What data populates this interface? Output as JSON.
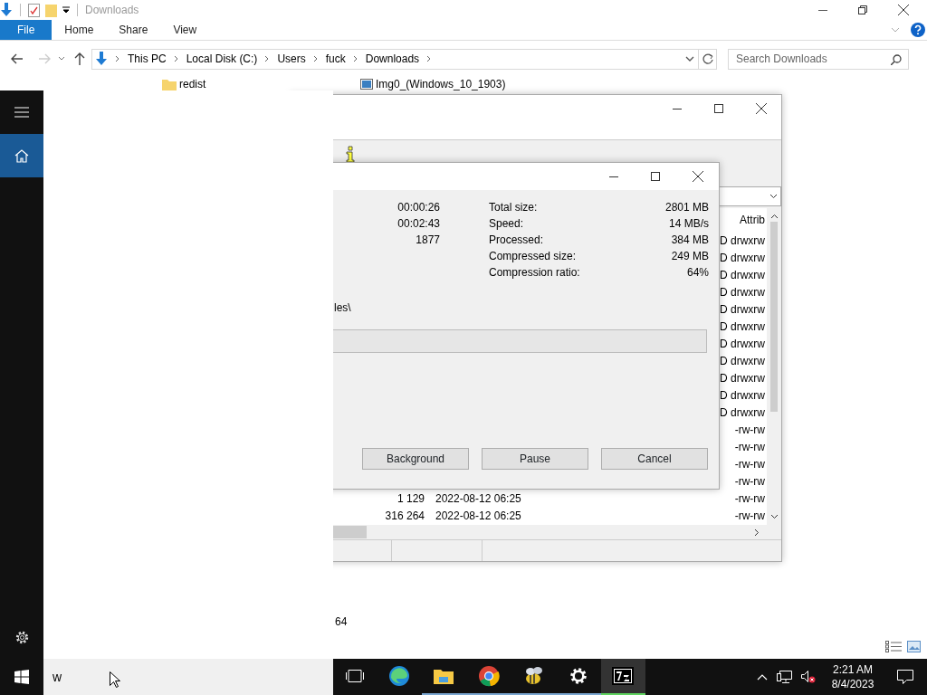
{
  "explorer": {
    "title": "Downloads",
    "ribbon_tabs": [
      {
        "label": "File",
        "selected": true
      },
      {
        "label": "Home",
        "selected": false
      },
      {
        "label": "Share",
        "selected": false
      },
      {
        "label": "View",
        "selected": false
      }
    ],
    "breadcrumb": [
      "This PC",
      "Local Disk (C:)",
      "Users",
      "fuck",
      "Downloads"
    ],
    "search": {
      "placeholder": "Search Downloads"
    },
    "items": [
      {
        "name": "redist",
        "kind": "folder"
      },
      {
        "name": "Img0_(Windows_10_1903)",
        "kind": "image"
      }
    ],
    "fragment": "64"
  },
  "file_manager": {
    "columns": [
      {
        "label": "Attrib"
      }
    ],
    "rows": [
      {
        "attrib": "D drwxrw"
      },
      {
        "attrib": "D drwxrw"
      },
      {
        "attrib": "D drwxrw"
      },
      {
        "attrib": "D drwxrw"
      },
      {
        "attrib": "D drwxrw"
      },
      {
        "attrib": "D drwxrw"
      },
      {
        "attrib": "D drwxrw"
      },
      {
        "attrib": "D drwxrw"
      },
      {
        "attrib": "D drwxrw"
      },
      {
        "attrib": "D drwxrw"
      },
      {
        "attrib": "D drwxrw"
      },
      {
        "attrib": "-rw-rw"
      },
      {
        "attrib": "-rw-rw"
      },
      {
        "attrib": "-rw-rw"
      },
      {
        "attrib": "-rw-rw"
      },
      {
        "size": "1 129",
        "modified": "2022-08-12 06:25",
        "attrib": "-rw-rw"
      },
      {
        "size": "316 264",
        "modified": "2022-08-12 06:25",
        "attrib": "-rw-rw"
      }
    ]
  },
  "progress_dialog": {
    "left_values": [
      "00:00:26",
      "00:02:43",
      "1877"
    ],
    "stats": [
      {
        "label": "Total size:",
        "value": "2801 MB"
      },
      {
        "label": "Speed:",
        "value": "14 MB/s"
      },
      {
        "label": "Processed:",
        "value": "384 MB"
      },
      {
        "label": "Compressed size:",
        "value": "249 MB"
      },
      {
        "label": "Compression ratio:",
        "value": "64%"
      }
    ],
    "path_fragment": "les\\",
    "level": 0,
    "buttons": [
      "Background",
      "Pause",
      "Cancel"
    ]
  },
  "start_menu": {
    "rail": [
      {
        "kind": "menu",
        "selected": false
      },
      {
        "kind": "home",
        "selected": true
      },
      {
        "kind": "settings",
        "selected": false
      }
    ]
  },
  "taskbar": {
    "search": {
      "value": "w"
    },
    "apps": [
      {
        "kind": "task-view",
        "running": false,
        "active": false
      },
      {
        "kind": "edge",
        "running": false,
        "active": false
      },
      {
        "kind": "explorer",
        "running": true,
        "active": false
      },
      {
        "kind": "chrome",
        "running": true,
        "active": false
      },
      {
        "kind": "bee",
        "running": true,
        "active": false
      },
      {
        "kind": "settings",
        "running": true,
        "active": false
      },
      {
        "kind": "sevenzip",
        "running": true,
        "active": true
      }
    ],
    "clock": {
      "time": "2:21 AM",
      "date": "8/4/2023"
    }
  }
}
